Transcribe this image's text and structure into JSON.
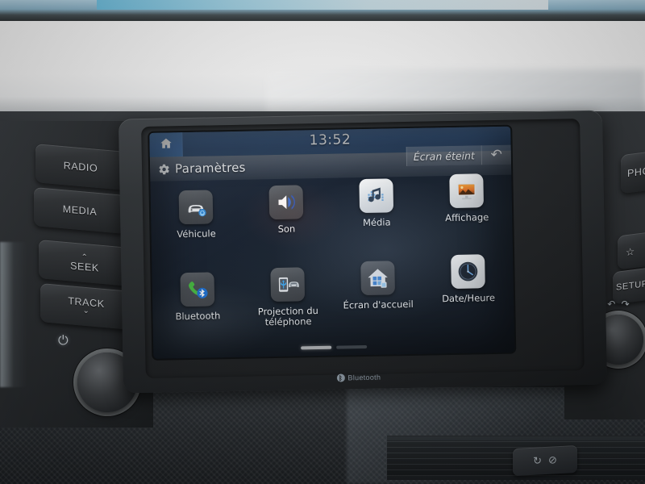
{
  "scene": {
    "description": "car-infotainment-touchscreen-photo"
  },
  "screen": {
    "statusbar": {
      "home_icon": "home-icon",
      "clock": "13:52"
    },
    "header": {
      "gear_icon": "gear-icon",
      "title": "Paramètres",
      "screen_off_label": "Écran éteint",
      "back_icon": "back-arrow-icon"
    },
    "menu": [
      {
        "label": "Véhicule",
        "icon": "car-settings-icon",
        "style": "dark"
      },
      {
        "label": "Son",
        "icon": "speaker-icon",
        "style": "dark"
      },
      {
        "label": "Média",
        "icon": "music-note-icon",
        "style": "light"
      },
      {
        "label": "Affichage",
        "icon": "display-monitor-icon",
        "style": "light"
      },
      {
        "label": "Bluetooth",
        "icon": "bluetooth-phone-icon",
        "style": "dark"
      },
      {
        "label": "Projection du téléphone",
        "icon": "phone-projection-icon",
        "style": "dark"
      },
      {
        "label": "Écran d'accueil",
        "icon": "home-screen-icon",
        "style": "dark"
      },
      {
        "label": "Date/Heure",
        "icon": "clock-icon",
        "style": "light"
      }
    ],
    "pagination": {
      "pages": 2,
      "active": 1
    }
  },
  "bezel": {
    "bluetooth_logo": "Bluetooth"
  },
  "hardware": {
    "left_buttons": [
      {
        "id": "radio",
        "label": "RADIO"
      },
      {
        "id": "media",
        "label": "MEDIA"
      },
      {
        "id": "seek",
        "label": "SEEK",
        "chevron": "⌃"
      },
      {
        "id": "track",
        "label": "TRACK",
        "chevron": "⌄"
      }
    ],
    "right_buttons": [
      {
        "id": "phone",
        "label": "PHO"
      },
      {
        "id": "fav",
        "label": "☆"
      },
      {
        "id": "setup",
        "label": "SETUP"
      }
    ],
    "power_icon": "power-icon",
    "volume_knob": "volume-knob",
    "tune_knob": "tune-knob",
    "tune_arrows": "↶ ↷",
    "climate_buttons": "recirculation-and-defrost"
  },
  "colors": {
    "topbar_blue": "#33527a",
    "home_blue": "#3d68a0",
    "screen_bg": "#16202f",
    "label_text": "#eef2f6",
    "bezel": "#24272a"
  }
}
